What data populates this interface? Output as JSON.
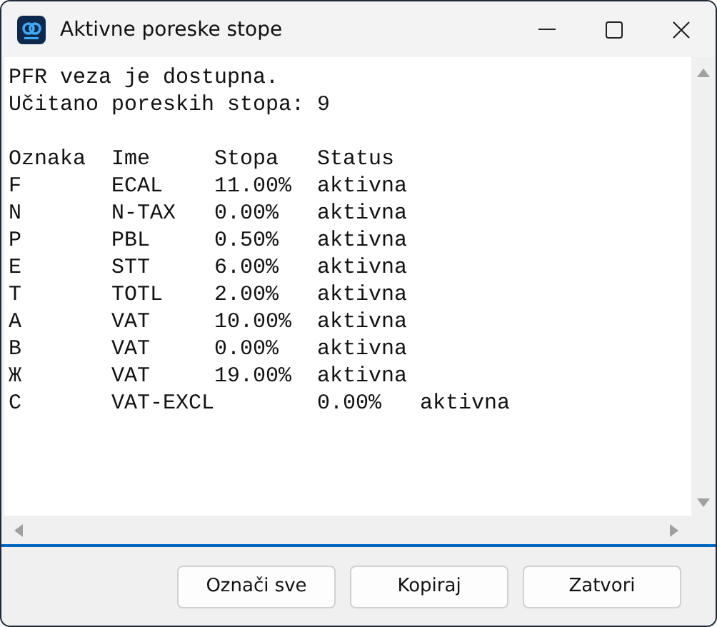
{
  "window": {
    "title": "Aktivne poreske stope"
  },
  "output": {
    "status_lines": [
      "PFR veza je dostupna.",
      "Učitano poreskih stopa: 9"
    ],
    "table_lines": [
      "Oznaka  Ime     Stopa   Status",
      "F       ECAL    11.00%  aktivna",
      "N       N-TAX   0.00%   aktivna",
      "P       PBL     0.50%   aktivna",
      "E       STT     6.00%   aktivna",
      "T       TOTL    2.00%   aktivna",
      "A       VAT     10.00%  aktivna",
      "B       VAT     0.00%   aktivna",
      "Ж       VAT     19.00%  aktivna",
      "C       VAT-EXCL        0.00%   aktivna"
    ]
  },
  "buttons": [
    "Označi sve",
    "Kopiraj",
    "Zatvori"
  ]
}
